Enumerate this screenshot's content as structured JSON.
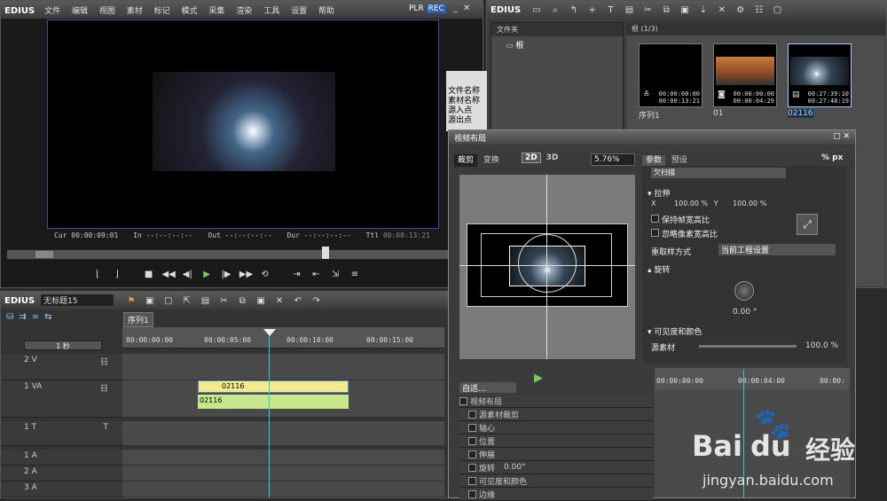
{
  "player": {
    "logo": "EDIUS",
    "menu": [
      "文件",
      "编辑",
      "视图",
      "素材",
      "标记",
      "模式",
      "采集",
      "渲染",
      "工具",
      "设置",
      "帮助"
    ],
    "plr": "PLR",
    "rec": "REC",
    "tc": {
      "cur_l": "Cur",
      "cur": "00:00:09:01",
      "in_l": "In",
      "in": "--:--:--:--",
      "out_l": "Out",
      "out": "--:--:--:--",
      "dur_l": "Dur",
      "dur": "--:--:--:--",
      "ttl_l": "Ttl",
      "ttl": "00:00:13:21"
    }
  },
  "bin": {
    "logo": "EDIUS",
    "folder_header": "文件夹",
    "root": "根",
    "path": "根 (1/3)",
    "clips": [
      {
        "name": "序列1",
        "tc1": "00:00:00:00",
        "tc2": "00:00:13:21"
      },
      {
        "name": "01",
        "tc1": "00:00:00:00",
        "tc2": "00:00:04:29"
      },
      {
        "name": "02116",
        "tc1": "00:27:39:10",
        "tc2": "00:27:48:19"
      }
    ],
    "side_labels": [
      "文件名称",
      "素材名称",
      "源入点",
      "源出点"
    ]
  },
  "timeline": {
    "logo": "EDIUS",
    "project": "无标题15",
    "seq_tab": "序列1",
    "scale": "1 秒",
    "ruler": [
      "00:00:00:00",
      "00:00:05:00",
      "00:00:10:00",
      "00:00:15:00"
    ],
    "tracks": [
      {
        "label": "2 V",
        "icon": "日"
      },
      {
        "label": "1 VA",
        "icon": "日"
      },
      {
        "label": "1 T",
        "icon": "T"
      },
      {
        "label": "1 A"
      },
      {
        "label": "2 A"
      },
      {
        "label": "3 A"
      }
    ],
    "clip_name": "02116",
    "audio_clip": "02116"
  },
  "dialog": {
    "title": "视频布局",
    "tabs": [
      "裁剪",
      "变换"
    ],
    "mode2d": "2D",
    "mode3d": "3D",
    "zoom": "5.76%",
    "right_tabs": [
      "参数",
      "预设"
    ],
    "pct": "%",
    "px": "px",
    "preset_select": "欠扫描",
    "stretch": "拉伸",
    "x_label": "X",
    "x_val": "100.00 %",
    "y_label": "Y",
    "y_val": "100.00 %",
    "keep_aspect": "保持帧宽高比",
    "ignore_pixel": "忽略像素宽高比",
    "resample": "重取样方式",
    "resample_val": "当前工程设置",
    "rotate": "旋转",
    "rotate_val": "0.00 °",
    "visibility": "可见度和颜色",
    "source": "源素材",
    "source_val": "100.0 %",
    "auto": "自适...",
    "list": [
      "视频布局",
      "源素材裁剪",
      "轴心",
      "位置",
      "伸展",
      "旋转",
      "可见度和颜色",
      "边缘"
    ],
    "rotate_inline": "0.00°",
    "kf_ruler": [
      "00:00:00:00",
      "00:00:04:00",
      "00:00:"
    ]
  },
  "watermark": {
    "brand": "Bai",
    "brand2": "du",
    "cn": "经验",
    "url": "jingyan.baidu.com"
  }
}
